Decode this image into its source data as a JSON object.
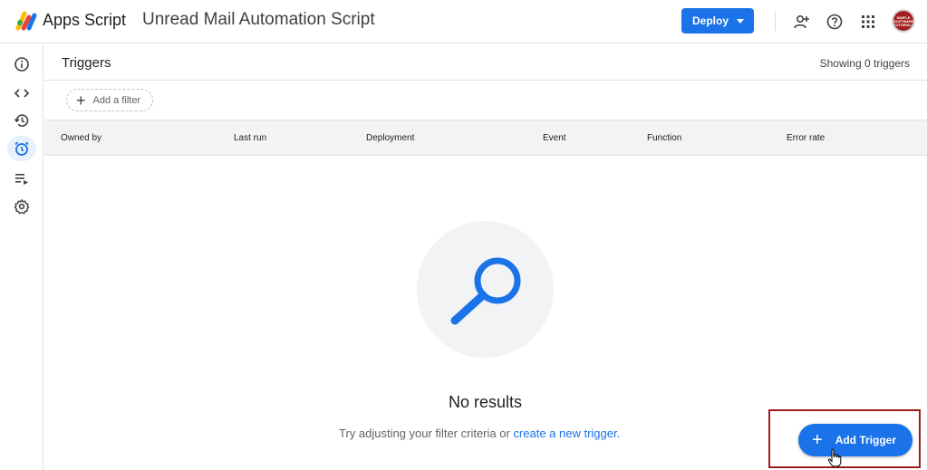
{
  "header": {
    "app_name": "Apps Script",
    "project_title": "Unread Mail Automation Script",
    "deploy_label": "Deploy",
    "avatar_text": "SIMPLE SOFTWARE TUTORIALS",
    "icons": [
      "add-person-icon",
      "help-icon",
      "apps-grid-icon"
    ]
  },
  "rail": {
    "items": [
      {
        "name": "overview",
        "icon": "info-icon"
      },
      {
        "name": "editor",
        "icon": "code-icon"
      },
      {
        "name": "executions",
        "icon": "history-icon"
      },
      {
        "name": "triggers",
        "icon": "alarm-clock-icon",
        "active": true
      },
      {
        "name": "executions-list",
        "icon": "playlist-icon"
      },
      {
        "name": "settings",
        "icon": "gear-icon"
      }
    ]
  },
  "page": {
    "title": "Triggers",
    "showing": "Showing 0 triggers",
    "filter_label": "Add a filter"
  },
  "table": {
    "columns": [
      "Owned by",
      "Last run",
      "Deployment",
      "Event",
      "Function",
      "Error rate"
    ]
  },
  "empty_state": {
    "title": "No results",
    "hint_prefix": "Try adjusting your filter criteria or",
    "hint_link": "create a new trigger."
  },
  "fab": {
    "label": "Add Trigger"
  },
  "colors": {
    "accent": "#1a73e8",
    "highlight": "#9b1c1c",
    "search_icon": "#1a73e8"
  }
}
